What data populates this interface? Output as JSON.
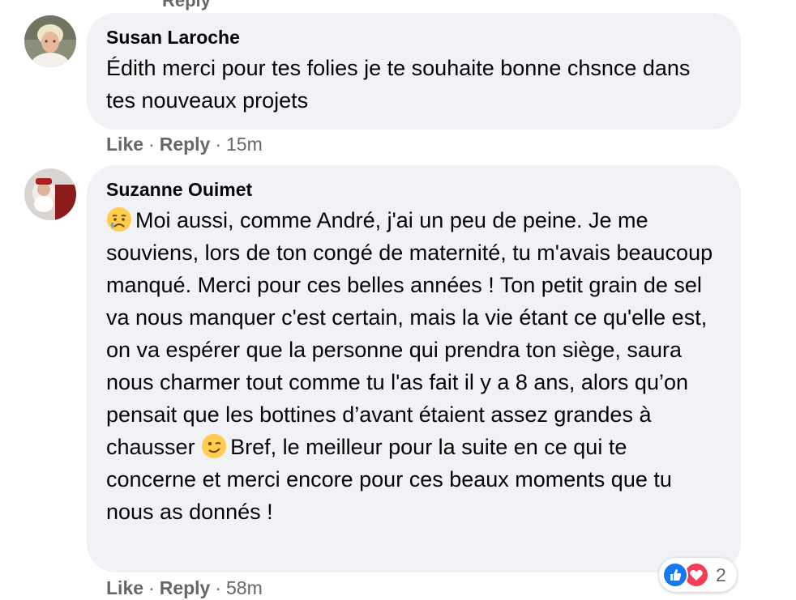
{
  "top_fragment": "Reply",
  "comments": [
    {
      "author": "Susan Laroche",
      "text": "Édith merci pour tes folies je te souhaite bonne chsnce dans tes nouveaux projets",
      "actions": {
        "like": "Like",
        "reply": "Reply",
        "time": "15m"
      }
    },
    {
      "author": "Suzanne Ouimet",
      "leading_emoji": "sad-but-relieved-face",
      "text_part1": "Moi aussi, comme André, j'ai un peu de peine. Je me souviens, lors de ton congé de maternité, tu m'avais beaucoup manqué. Merci pour ces belles années ! Ton petit grain de sel va nous manquer c'est certain, mais la vie étant ce qu'elle est, on va espérer que la personne qui prendra ton siège, saura nous charmer tout comme tu l'as fait il y a 8 ans, alors qu’on pensait que les bottines d’avant étaient assez grandes à chausser",
      "inline_emoji": "winking-face",
      "text_part2": "Bref, le meilleur pour la suite en ce qui te concerne et merci encore pour ces beaux moments que tu nous as donnés !",
      "actions": {
        "like": "Like",
        "reply": "Reply",
        "time": "58m"
      },
      "reactions": {
        "icons": [
          "like-icon",
          "love-icon"
        ],
        "count": "2"
      }
    }
  ],
  "action_separator": "·",
  "colors": {
    "bubble": "#f0f2f5",
    "meta_text": "#65676b",
    "like_blue": "#1877f2",
    "love_red": "#f33e58"
  }
}
